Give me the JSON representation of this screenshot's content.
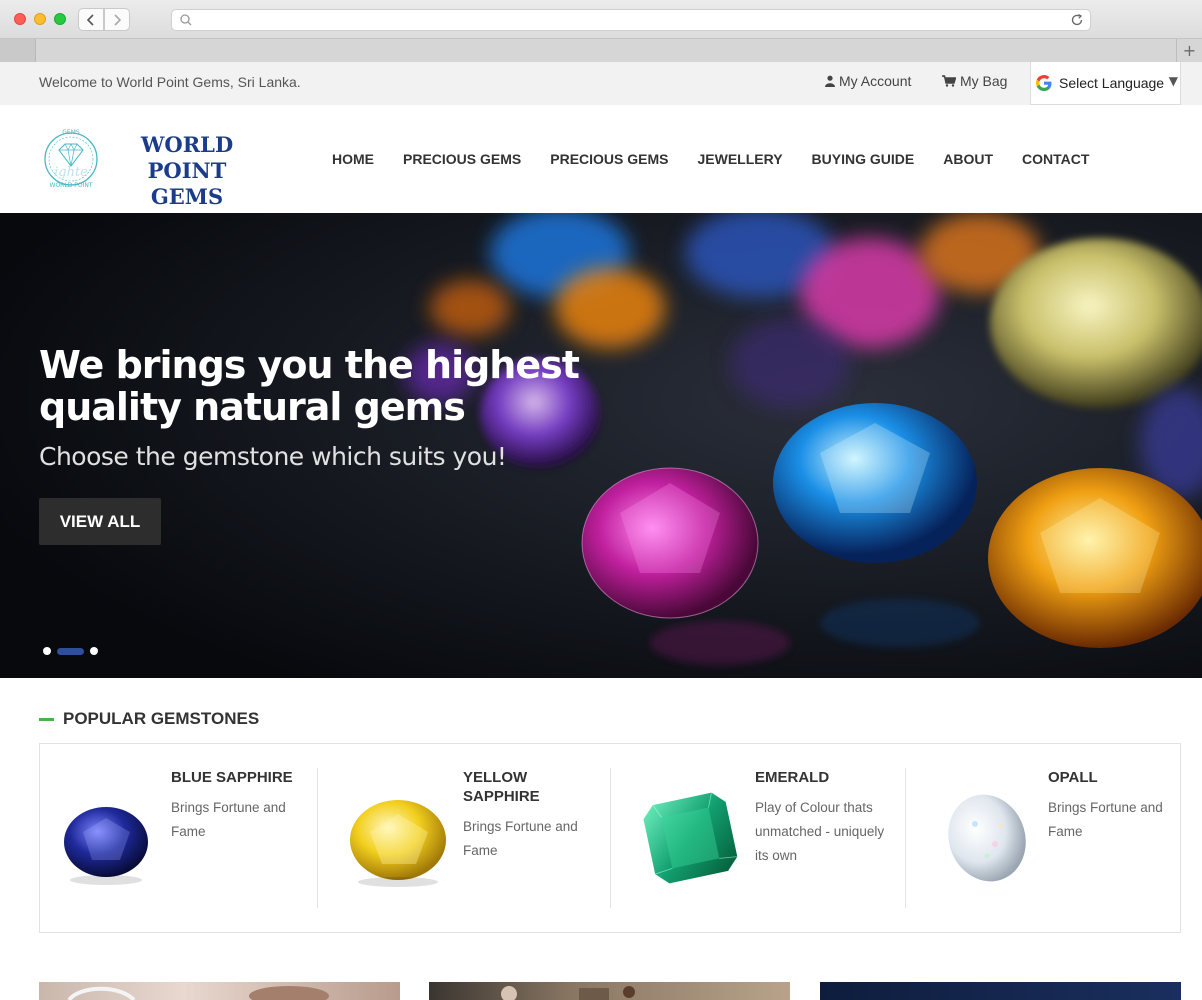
{
  "browser": {
    "back_icon": "chevron-left-icon",
    "forward_icon": "chevron-right-icon",
    "url": "",
    "new_tab_label": "+"
  },
  "topbar": {
    "welcome": "Welcome to World Point Gems, Sri Lanka.",
    "account": "My Account",
    "bag": "My Bag",
    "language": "Select Language"
  },
  "logo": {
    "line1": "WORLD POINT",
    "line2": "GEMS"
  },
  "nav": {
    "items": [
      "HOME",
      "PRECIOUS GEMS",
      "PRECIOUS GEMS",
      "JEWELLERY",
      "BUYING GUIDE",
      "ABOUT",
      "CONTACT"
    ]
  },
  "hero": {
    "title": "We brings you the highest quality natural gems",
    "subtitle": "Choose the gemstone which suits you!",
    "button": "VIEW ALL",
    "slide_count": 3,
    "active_slide": 2
  },
  "popular": {
    "title": "POPULAR GEMSTONES",
    "gems": [
      {
        "name": "BLUE SAPPHIRE",
        "desc": "Brings Fortune and Fame",
        "color": "#1f2a9c"
      },
      {
        "name": "YELLOW SAPPHIRE",
        "desc": "Brings Fortune and Fame",
        "color": "#f2cf1e"
      },
      {
        "name": "EMERALD",
        "desc": "Play of Colour thats unmatched - uniquely its own",
        "color": "#12a070"
      },
      {
        "name": "OPALL",
        "desc": "Brings Fortune and Fame",
        "color": "#dfe6ee"
      }
    ]
  },
  "colors": {
    "brand_blue": "#1a3c8a",
    "accent_green": "#4caf50",
    "slider_active": "#2f4f9e"
  }
}
